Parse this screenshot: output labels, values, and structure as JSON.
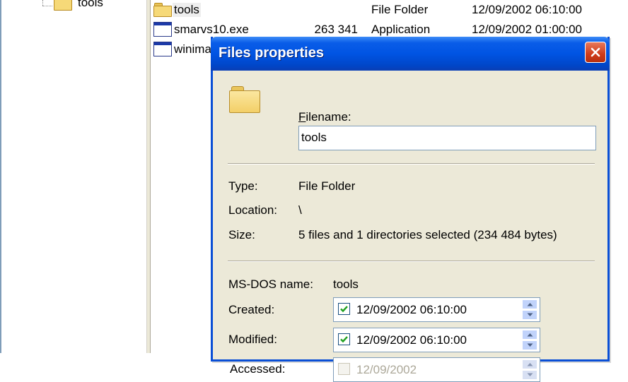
{
  "tree": {
    "item_label": "tools"
  },
  "files": [
    {
      "name": "tools",
      "size": "",
      "type": "File Folder",
      "date": "12/09/2002  06:10:00",
      "icon": "folder-icon",
      "selected": true
    },
    {
      "name": "smarvs10.exe",
      "size": "263 341",
      "type": "Application",
      "date": "12/09/2002  01:00:00",
      "icon": "application-icon",
      "selected": false
    },
    {
      "name": "winima",
      "size": "",
      "type": "",
      "date": "",
      "icon": "application-icon",
      "selected": false
    }
  ],
  "dialog": {
    "title": "Files properties",
    "filename_label": "Filename:",
    "filename_value": "tools",
    "type_label": "Type:",
    "type_value": "File Folder",
    "location_label": "Location:",
    "location_value": "\\",
    "size_label": "Size:",
    "size_value": "5 files and 1 directories selected (234 484 bytes)",
    "msdos_label": "MS-DOS name:",
    "msdos_value": "tools",
    "created_label": "Created:",
    "created_value": "12/09/2002 06:10:00",
    "modified_label": "Modified:",
    "modified_value": "12/09/2002 06:10:00",
    "accessed_label": "Accessed:",
    "accessed_value": "12/09/2002"
  },
  "colors": {
    "titlebar": "#0054e3",
    "dialog_bg": "#ece9d8",
    "close_button": "#cf3b1a",
    "check_green": "#21a121"
  }
}
